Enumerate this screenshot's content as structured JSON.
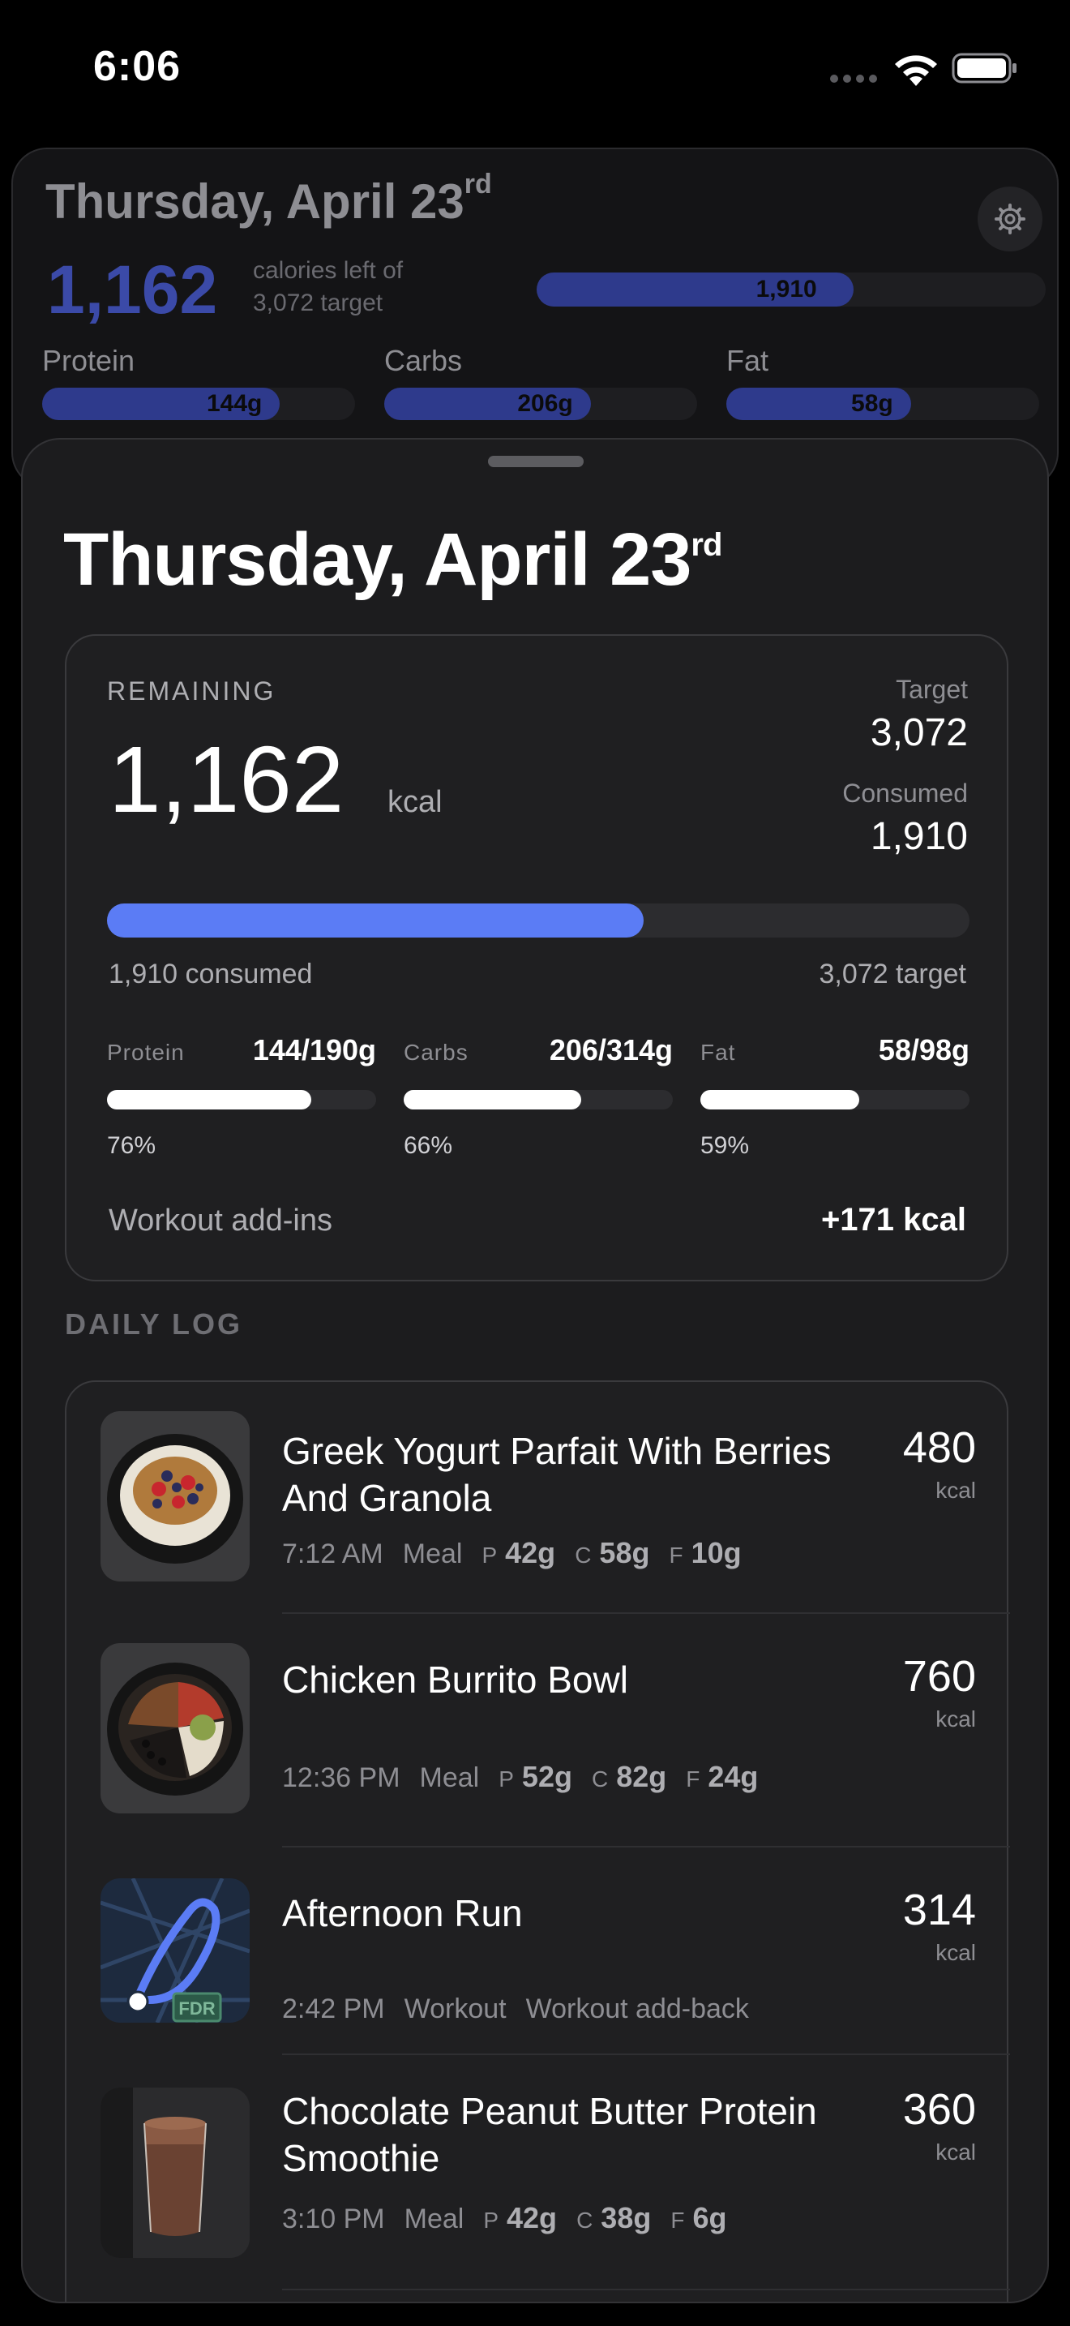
{
  "status_bar": {
    "time": "6:06"
  },
  "header_card": {
    "title_main": "Thursday, April 23",
    "title_suffix": "rd",
    "remaining_value": "1,162",
    "remaining_note_line1": "calories left of",
    "remaining_note_line2": "3,072 target",
    "consumed_bar_label": "1,910",
    "consumed_fraction": 0.622,
    "macros": [
      {
        "name": "Protein",
        "value": "144g",
        "fraction": 0.76
      },
      {
        "name": "Carbs",
        "value": "206g",
        "fraction": 0.66
      },
      {
        "name": "Fat",
        "value": "58g",
        "fraction": 0.59
      }
    ]
  },
  "sheet": {
    "title_main": "Thursday, April 23",
    "title_suffix": "rd",
    "summary": {
      "remaining_label": "REMAINING",
      "remaining_value": "1,162",
      "remaining_unit": "kcal",
      "target_label": "Target",
      "target_value": "3,072",
      "consumed_label": "Consumed",
      "consumed_value": "1,910",
      "progress_fraction": 0.622,
      "consumed_caption": "1,910 consumed",
      "target_caption": "3,072 target",
      "macros": [
        {
          "name": "Protein",
          "amount": "144/190g",
          "fraction": 0.76,
          "percent": "76%"
        },
        {
          "name": "Carbs",
          "amount": "206/314g",
          "fraction": 0.66,
          "percent": "66%"
        },
        {
          "name": "Fat",
          "amount": "58/98g",
          "fraction": 0.59,
          "percent": "59%"
        }
      ],
      "addins_label": "Workout add-ins",
      "addins_value": "+171 kcal"
    },
    "daily_log_heading": "DAILY LOG",
    "log": [
      {
        "name": "Greek Yogurt Parfait With Berries And Granola",
        "time": "7:12 AM",
        "kind": "Meal",
        "p": "42g",
        "c": "58g",
        "f": "10g",
        "kcal": "480",
        "unit": "kcal"
      },
      {
        "name": "Chicken Burrito Bowl",
        "time": "12:36 PM",
        "kind": "Meal",
        "p": "52g",
        "c": "82g",
        "f": "24g",
        "kcal": "760",
        "unit": "kcal"
      },
      {
        "name": "Afternoon Run",
        "time": "2:42 PM",
        "kind": "Workout",
        "note": "Workout add-back",
        "kcal": "314",
        "unit": "kcal",
        "map_badge": "FDR"
      },
      {
        "name": "Chocolate Peanut Butter Protein Smoothie",
        "time": "3:10 PM",
        "kind": "Meal",
        "p": "42g",
        "c": "38g",
        "f": "6g",
        "kcal": "360",
        "unit": "kcal"
      }
    ],
    "macro_keys": {
      "p": "P",
      "c": "C",
      "f": "F"
    }
  }
}
